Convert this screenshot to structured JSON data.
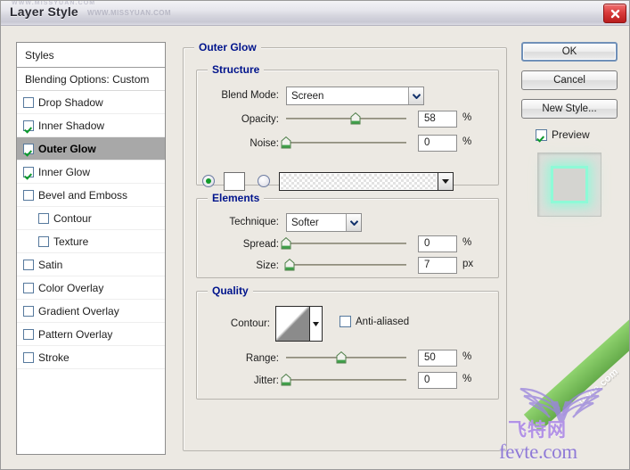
{
  "window": {
    "title": "Layer Style",
    "title_watermark": "WWW.MISSYUAN.COM",
    "title_watermark_top": "WWW.MISSYUAN.COM",
    "close_icon": "close-icon"
  },
  "styles_panel": {
    "header": "Styles",
    "blending_options": "Blending Options: Custom",
    "effects": [
      {
        "label": "Drop Shadow",
        "checked": false,
        "selected": false,
        "indent": false
      },
      {
        "label": "Inner Shadow",
        "checked": true,
        "selected": false,
        "indent": false
      },
      {
        "label": "Outer Glow",
        "checked": true,
        "selected": true,
        "indent": false
      },
      {
        "label": "Inner Glow",
        "checked": true,
        "selected": false,
        "indent": false
      },
      {
        "label": "Bevel and Emboss",
        "checked": false,
        "selected": false,
        "indent": false
      },
      {
        "label": "Contour",
        "checked": false,
        "selected": false,
        "indent": true
      },
      {
        "label": "Texture",
        "checked": false,
        "selected": false,
        "indent": true
      },
      {
        "label": "Satin",
        "checked": false,
        "selected": false,
        "indent": false
      },
      {
        "label": "Color Overlay",
        "checked": false,
        "selected": false,
        "indent": false
      },
      {
        "label": "Gradient Overlay",
        "checked": false,
        "selected": false,
        "indent": false
      },
      {
        "label": "Pattern Overlay",
        "checked": false,
        "selected": false,
        "indent": false
      },
      {
        "label": "Stroke",
        "checked": false,
        "selected": false,
        "indent": false
      }
    ]
  },
  "main": {
    "panel_title": "Outer Glow",
    "structure": {
      "title": "Structure",
      "blend_mode_label": "Blend Mode:",
      "blend_mode_value": "Screen",
      "opacity_label": "Opacity:",
      "opacity_value": "58",
      "opacity_unit": "%",
      "opacity_percent": 58,
      "noise_label": "Noise:",
      "noise_value": "0",
      "noise_unit": "%",
      "noise_percent": 0,
      "fill_type": "color",
      "color_swatch": "#ffffff"
    },
    "elements": {
      "title": "Elements",
      "technique_label": "Technique:",
      "technique_value": "Softer",
      "spread_label": "Spread:",
      "spread_value": "0",
      "spread_unit": "%",
      "spread_percent": 0,
      "size_label": "Size:",
      "size_value": "7",
      "size_unit": "px",
      "size_percent": 3
    },
    "quality": {
      "title": "Quality",
      "contour_label": "Contour:",
      "antialiased_label": "Anti-aliased",
      "antialiased_checked": false,
      "range_label": "Range:",
      "range_value": "50",
      "range_unit": "%",
      "range_percent": 46,
      "jitter_label": "Jitter:",
      "jitter_value": "0",
      "jitter_unit": "%",
      "jitter_percent": 0
    }
  },
  "buttons": {
    "ok": "OK",
    "cancel": "Cancel",
    "new_style": "New Style...",
    "preview_label": "Preview",
    "preview_checked": true
  },
  "watermark": {
    "chinese": "飞特网",
    "domain": "fevte.com",
    "ribbon": "fevte.com"
  },
  "colors": {
    "accent_blue": "#00148c",
    "selection_grey": "#a8a8a8",
    "glow_mint": "#8cfad7",
    "close_red": "#d83a3a",
    "check_green": "#0c9a2c"
  }
}
